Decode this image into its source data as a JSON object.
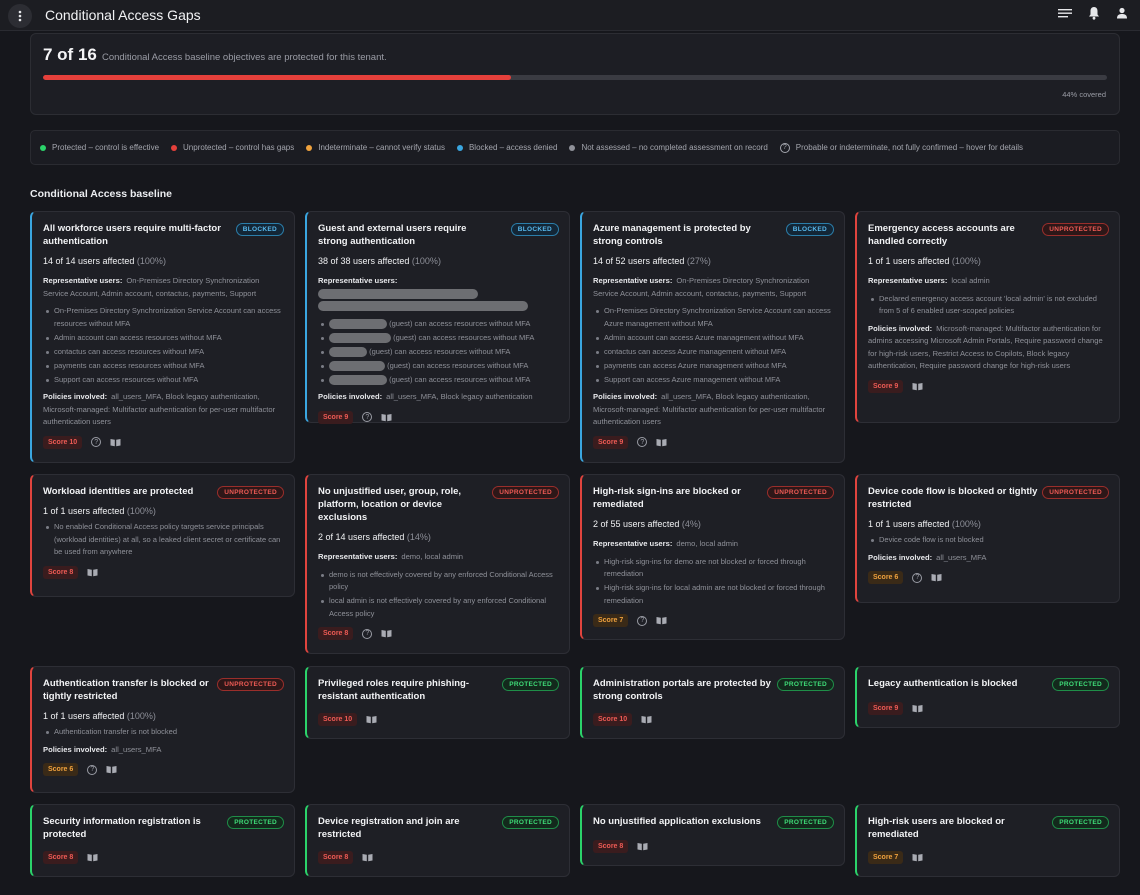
{
  "app": {
    "title": "Conditional Access Gaps"
  },
  "summary": {
    "count": "7 of 16",
    "text": "Conditional Access baseline objectives are protected for this tenant.",
    "covered": "44% covered",
    "progress": 0.44
  },
  "legend": [
    {
      "label": "Protected – control is effective",
      "color": "#2bd36a"
    },
    {
      "label": "Unprotected – control has gaps",
      "color": "#e5403b"
    },
    {
      "label": "Indeterminate – cannot verify status",
      "color": "#f0a23d"
    },
    {
      "label": "Blocked – access denied",
      "color": "#3aa6e0"
    },
    {
      "label": "Not assessed – no completed assessment on record",
      "color": "#8f9199"
    },
    {
      "label": "Probable or indeterminate, not fully confirmed – hover for details",
      "icon": "question-icon"
    }
  ],
  "section": {
    "title": "Conditional Access baseline"
  },
  "cards": {
    "c1": {
      "title": "All workforce users require multi-factor authentication",
      "badge": "BLOCKED",
      "affected": "14 of 14 users affected",
      "pct": "(100%)",
      "rep_label": "Representative users:",
      "rep": "On-Premises Directory Synchronization Service Account, Admin account, contactus, payments, Support",
      "bullets": [
        "On-Premises Directory Synchronization Service Account can access resources without MFA",
        "Admin account can access resources without MFA",
        "contactus can access resources without MFA",
        "payments can access resources without MFA",
        "Support can access resources without MFA"
      ],
      "pol_label": "Policies involved:",
      "pol": "all_users_MFA, Block legacy authentication, Microsoft-managed: Multifactor authentication for per-user multifactor authentication users",
      "score": "Score 10"
    },
    "c2": {
      "title": "Guest and external users require strong authentication",
      "badge": "BLOCKED",
      "affected": "38 of 38 users affected",
      "pct": "(100%)",
      "rep_label": "Representative users:",
      "bullets": [
        "(guest) can access resources without MFA",
        "(guest) can access resources without MFA",
        "(guest) can access resources without MFA",
        "(guest) can access resources without MFA",
        "(guest) can access resources without MFA"
      ],
      "pol_label": "Policies involved:",
      "pol": "all_users_MFA, Block legacy authentication",
      "score": "Score 9"
    },
    "c3": {
      "title": "Azure management is protected by strong controls",
      "badge": "BLOCKED",
      "affected": "14 of 52 users affected",
      "pct": "(27%)",
      "rep_label": "Representative users:",
      "rep": "On-Premises Directory Synchronization Service Account, Admin account, contactus, payments, Support",
      "bullets": [
        "On-Premises Directory Synchronization Service Account can access Azure management without MFA",
        "Admin account can access Azure management without MFA",
        "contactus can access Azure management without MFA",
        "payments can access Azure management without MFA",
        "Support can access Azure management without MFA"
      ],
      "pol_label": "Policies involved:",
      "pol": "all_users_MFA, Block legacy authentication, Microsoft-managed: Multifactor authentication for per-user multifactor authentication users",
      "score": "Score 9"
    },
    "c4": {
      "title": "Emergency access accounts are handled correctly",
      "badge": "UNPROTECTED",
      "affected": "1 of 1 users affected",
      "pct": "(100%)",
      "rep_label": "Representative users:",
      "rep": "local admin",
      "bullets": [
        "Declared emergency access account 'local admin' is not excluded from 5 of 6 enabled user-scoped policies"
      ],
      "pol_label": "Policies involved:",
      "pol": "Microsoft-managed: Multifactor authentication for admins accessing Microsoft Admin Portals, Require password change for high-risk users, Restrict Access to Copilots, Block legacy authentication, Require password change for high-risk users",
      "score": "Score 9"
    },
    "c5": {
      "title": "Workload identities are protected",
      "badge": "UNPROTECTED",
      "affected": "1 of 1 users affected",
      "pct": "(100%)",
      "bullets": [
        "No enabled Conditional Access policy targets service principals (workload identities) at all, so a leaked client secret or certificate can be used from anywhere"
      ],
      "score": "Score 8"
    },
    "c6": {
      "title": "No unjustified user, group, role, platform, location or device exclusions",
      "badge": "UNPROTECTED",
      "affected": "2 of 14 users affected",
      "pct": "(14%)",
      "rep_label": "Representative users:",
      "rep": "demo, local admin",
      "bullets": [
        "demo is not effectively covered by any enforced Conditional Access policy",
        "local admin is not effectively covered by any enforced Conditional Access policy"
      ],
      "score": "Score 8"
    },
    "c7": {
      "title": "High-risk sign-ins are blocked or remediated",
      "badge": "UNPROTECTED",
      "affected": "2 of 55 users affected",
      "pct": "(4%)",
      "rep_label": "Representative users:",
      "rep": "demo, local admin",
      "bullets": [
        "High-risk sign-ins for demo are not blocked or forced through remediation",
        "High-risk sign-ins for local admin are not blocked or forced through remediation"
      ],
      "score": "Score 7"
    },
    "c8": {
      "title": "Device code flow is blocked or tightly restricted",
      "badge": "UNPROTECTED",
      "affected": "1 of 1 users affected",
      "pct": "(100%)",
      "bullets": [
        "Device code flow is not blocked"
      ],
      "pol_label": "Policies involved:",
      "pol": "all_users_MFA",
      "score": "Score 6"
    },
    "c9": {
      "title": "Authentication transfer is blocked or tightly restricted",
      "badge": "UNPROTECTED",
      "affected": "1 of 1 users affected",
      "pct": "(100%)",
      "bullets": [
        "Authentication transfer is not blocked"
      ],
      "pol_label": "Policies involved:",
      "pol": "all_users_MFA",
      "score": "Score 6"
    },
    "c10": {
      "title": "Privileged roles require phishing-resistant authentication",
      "badge": "PROTECTED",
      "score": "Score 10"
    },
    "c11": {
      "title": "Administration portals are protected by strong controls",
      "badge": "PROTECTED",
      "score": "Score 10"
    },
    "c12": {
      "title": "Legacy authentication is blocked",
      "badge": "PROTECTED",
      "score": "Score 9"
    },
    "c13": {
      "title": "Security information registration is protected",
      "badge": "PROTECTED",
      "score": "Score 8"
    },
    "c14": {
      "title": "Device registration and join are restricted",
      "badge": "PROTECTED",
      "score": "Score 8"
    },
    "c15": {
      "title": "No unjustified application exclusions",
      "badge": "PROTECTED",
      "score": "Score 8"
    },
    "c16": {
      "title": "High-risk users are blocked or remediated",
      "badge": "PROTECTED",
      "score": "Score 7"
    }
  }
}
